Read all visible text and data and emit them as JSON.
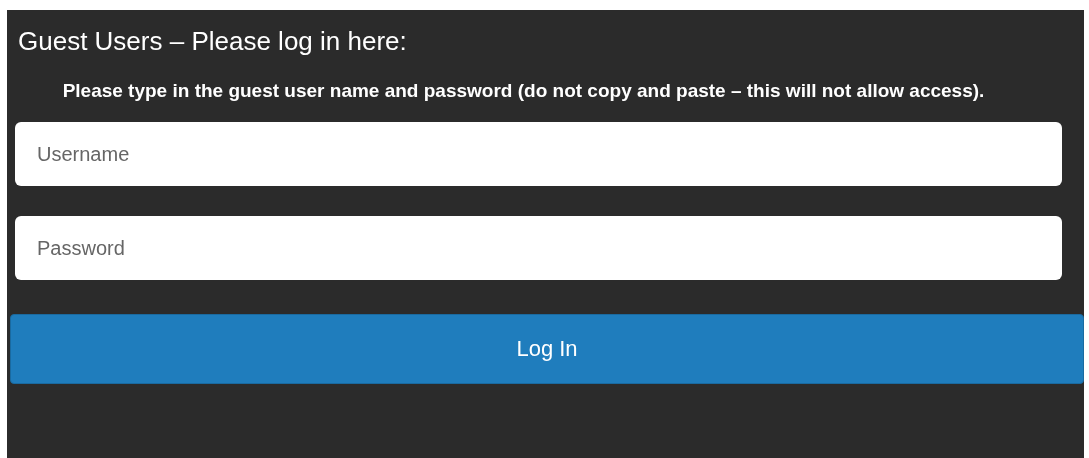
{
  "panel": {
    "title": "Guest Users – Please log in here:",
    "instructions": "Please type in the guest user name and password (do not copy and paste – this will not allow access).",
    "fields": [
      {
        "placeholder": "Username"
      },
      {
        "placeholder": "Password"
      }
    ],
    "button": "Log In"
  }
}
